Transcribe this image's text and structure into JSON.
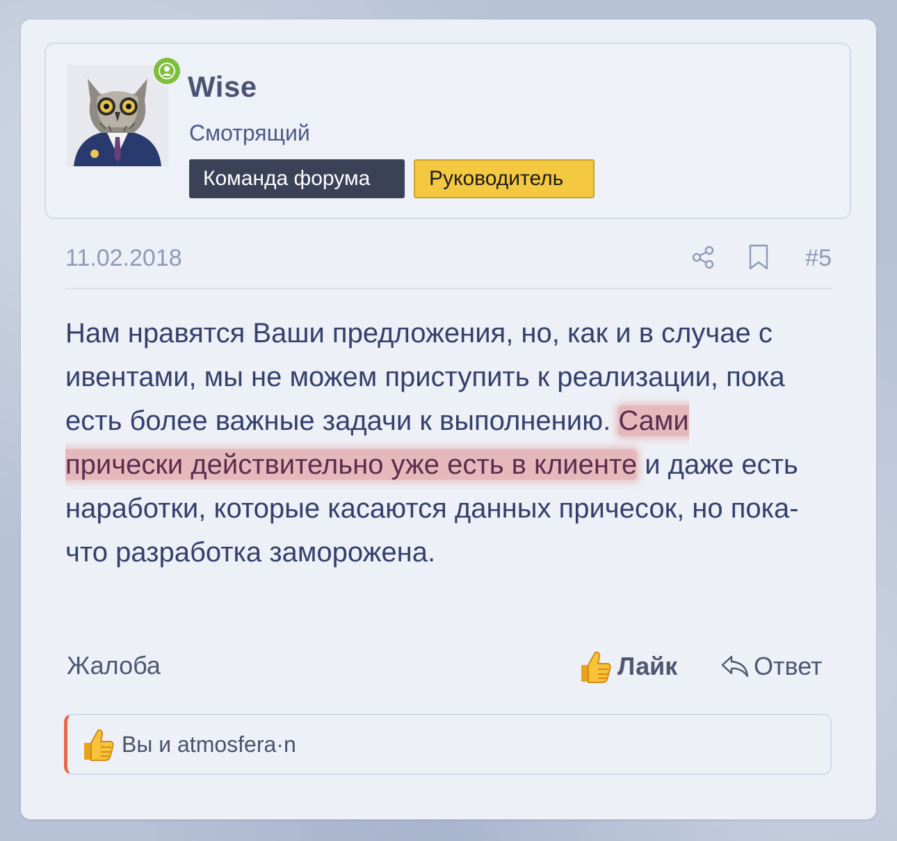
{
  "user": {
    "name": "Wise",
    "title": "Смотрящий",
    "status": "online",
    "avatar_icon": "owl-avatar-icon",
    "badges": [
      {
        "label": "Команда форума",
        "color": "#3b4257"
      },
      {
        "label": "Руководитель",
        "color": "#f5c842"
      }
    ]
  },
  "post": {
    "date": "11.02.2018",
    "number": "#5",
    "share_icon": "share-icon",
    "bookmark_icon": "bookmark-icon",
    "text_before": "Нам нравятся Ваши предложения, но, как и в случае с ивентами, мы не можем приступить к реализации, пока есть более важные задачи к выполнению. ",
    "text_highlight": "Сами прически действительно уже есть в клиенте",
    "text_after": " и даже есть наработки, которые касаются данных причесок, но пока-что разработка заморожена.",
    "highlight_color": "#de8c8c"
  },
  "actions": {
    "report_label": "Жалоба",
    "like_label": "Лайк",
    "reply_label": "Ответ"
  },
  "reactions": {
    "text": "Вы и atmosfera·n",
    "accent_color": "#e8684a"
  }
}
